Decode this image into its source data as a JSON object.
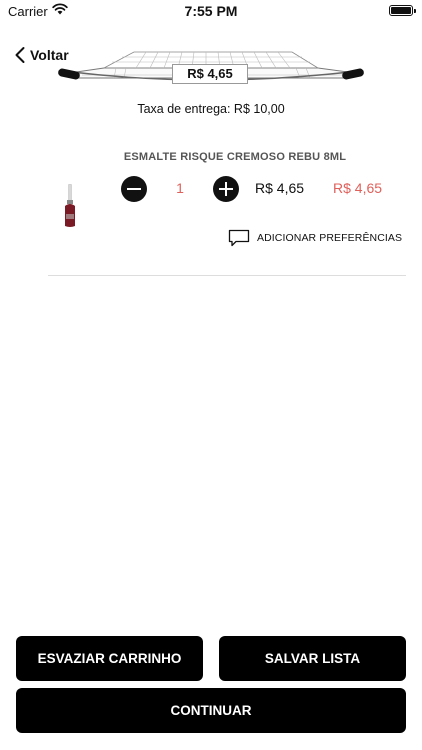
{
  "status_bar": {
    "carrier": "Carrier",
    "time": "7:55 PM",
    "wifi_icon": "wifi-icon",
    "battery_icon": "battery-icon"
  },
  "header": {
    "back_label": "Voltar",
    "back_icon": "chevron-left-icon",
    "cart_icon": "shopping-cart-icon",
    "cart_total": "R$ 4,65"
  },
  "delivery_fee": "Taxa de entrega: R$ 10,00",
  "cart_items": [
    {
      "name": "ESMALTE RISQUE CREMOSO REBU 8ML",
      "image_icon": "nail-polish-bottle-icon",
      "quantity": "1",
      "unit_price": "R$ 4,65",
      "total_price": "R$ 4,65",
      "preferences_label": "ADICIONAR PREFERÊNCIAS",
      "preferences_icon": "comment-icon"
    }
  ],
  "actions": {
    "empty_cart": "ESVAZIAR CARRINHO",
    "save_list": "SALVAR LISTA",
    "continue": "CONTINUAR"
  },
  "colors": {
    "accent_red": "#e0605a",
    "button_bg": "#000000",
    "button_text": "#ffffff"
  }
}
